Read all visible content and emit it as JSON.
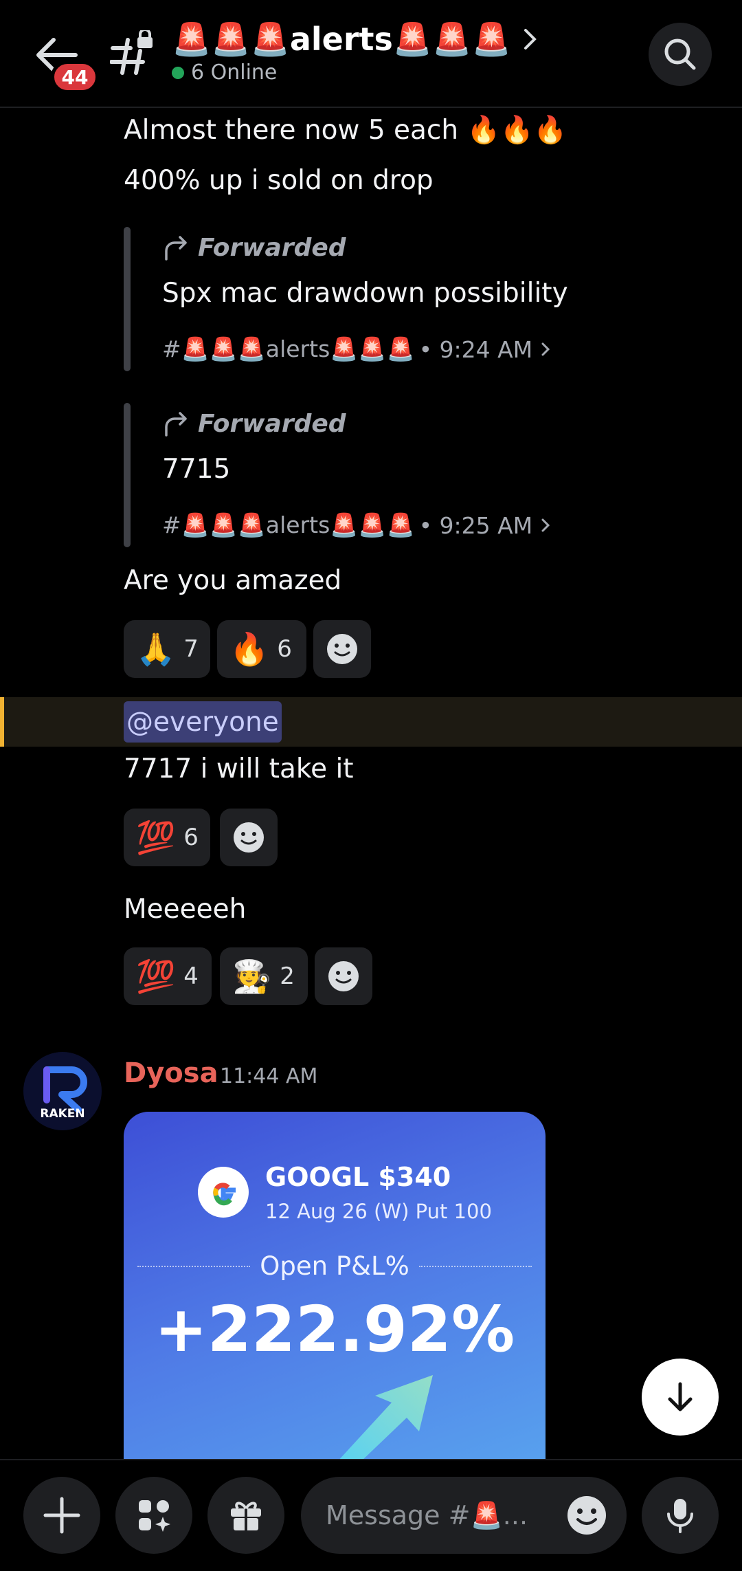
{
  "header": {
    "title": "🚨🚨🚨alerts🚨🚨🚨",
    "unread_badge": "44",
    "online_text": "6 Online"
  },
  "messages": {
    "line1": "Almost there now 5 each 🔥🔥🔥",
    "line2": "400% up i sold on drop",
    "forward1": {
      "label": "Forwarded",
      "text": "Spx mac drawdown possibility",
      "channel": "#🚨🚨🚨alerts🚨🚨🚨",
      "time": "• 9:24 AM"
    },
    "forward2": {
      "label": "Forwarded",
      "text": "7715",
      "channel": "#🚨🚨🚨alerts🚨🚨🚨",
      "time": "• 9:25 AM"
    },
    "amazed": "Are you amazed",
    "reactions_amazed": [
      {
        "emoji": "🙏",
        "count": "7"
      },
      {
        "emoji": "🔥",
        "count": "6"
      }
    ],
    "mention": "@everyone",
    "take_it": "7717 i will take it",
    "reactions_take_it": [
      {
        "emoji": "💯",
        "count": "6"
      }
    ],
    "meeeeeh": "Meeeeeh",
    "reactions_meeeeeh": [
      {
        "emoji": "💯",
        "count": "4"
      },
      {
        "emoji": "🧑‍🍳",
        "count": "2"
      }
    ]
  },
  "post": {
    "author": "Dyosa",
    "time": "11:44 AM",
    "avatar_text": "RAKEN",
    "card": {
      "ticker": "GOOGL $340",
      "contract": "12 Aug 26 (W) Put 100",
      "pl_label": "Open P&L%",
      "pl_value": "+222.92%"
    }
  },
  "composer": {
    "placeholder": "Message #🚨..."
  },
  "colors": {
    "accent_mention": "#f0b232",
    "author": "#e8645a",
    "online": "#23a55a",
    "badge": "#da373c"
  }
}
